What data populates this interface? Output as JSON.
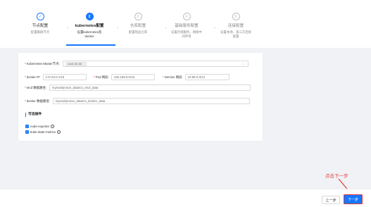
{
  "steps": [
    {
      "title": "节点配置",
      "desc": "配置集群节点",
      "state": "done",
      "icon": "check-icon",
      "mark": "✓"
    },
    {
      "title": "kubernetes配置",
      "desc": "设置kubernetes及docker",
      "state": "active",
      "mark": "2"
    },
    {
      "title": "仓库配置",
      "desc": "配置制品仓库",
      "state": "todo",
      "mark": "3"
    },
    {
      "title": "基础服务配置",
      "desc": "设置存储服务、网络中间件等",
      "state": "todo",
      "mark": "4"
    },
    {
      "title": "连接配置",
      "desc": "设置本地、第三方连接配置",
      "state": "todo",
      "mark": "5"
    }
  ],
  "form": {
    "master": {
      "label": "Kubernetes Master节点:",
      "tag": "node-66-58",
      "tag_close": "×",
      "chevron": "⌵"
    },
    "docker_ip": {
      "label": "docker IP:",
      "value": "172.33.0.1/16"
    },
    "pod_net": {
      "label": "Pod 网段:",
      "value": "192.169.0.0/16"
    },
    "service_net": {
      "label": "Service 网段:",
      "value": "10.96.0.0/12"
    },
    "etcd_path": {
      "label": "etcd 数据路径:",
      "value": "/sysvol/proton_data/cs_etcd_data"
    },
    "docker_path": {
      "label": "docker 数据路径:",
      "value": "/sysvol/proton_data/cs_docker_data"
    },
    "required_mark": "*"
  },
  "addons": {
    "title": "可选插件",
    "items": [
      {
        "label": "node-exporter",
        "checked": true
      },
      {
        "label": "kube-state-metrics",
        "checked": true
      }
    ],
    "check_mark": "✓",
    "help_mark": "?"
  },
  "footer": {
    "prev_label": "上一步",
    "next_label": "下一步"
  },
  "annotation": {
    "text": "点击下一步",
    "color": "#e03a3a"
  },
  "colors": {
    "accent": "#1677ff",
    "required": "#f5222d"
  }
}
